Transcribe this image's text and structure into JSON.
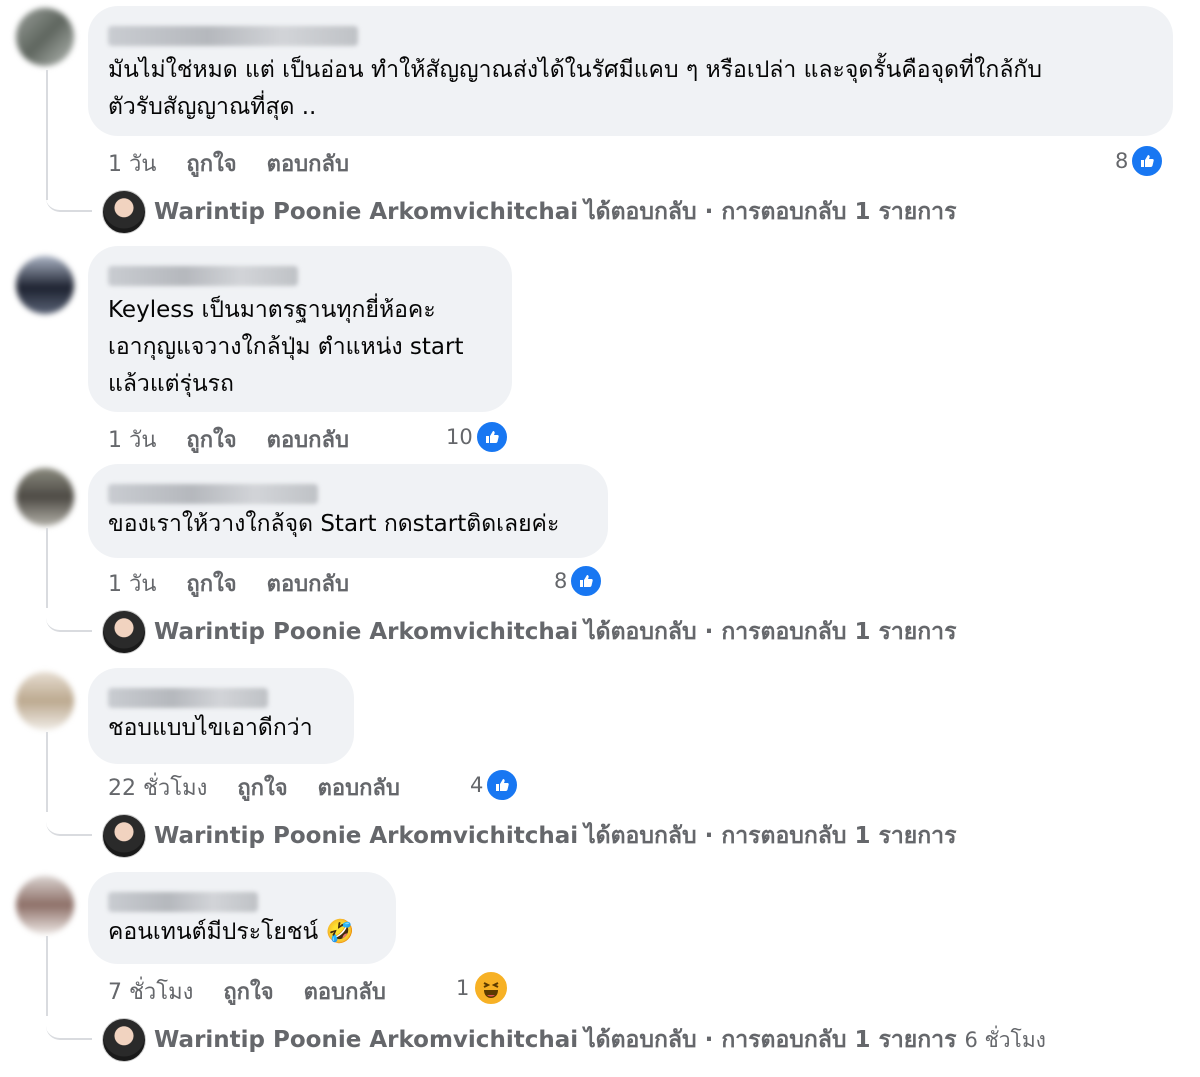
{
  "comments": [
    {
      "text": "มันไม่ใช่หมด แต่ เป็นอ่อน ทำให้สัญญาณส่งได้ในรัศมีแคบ ๆ หรือเปล่า และจุดรั้นคือจุดที่ใกล้กับ\nตัวรับสัญญาณที่สุด ..",
      "time": "1 วัน",
      "like_label": "ถูกใจ",
      "reply_label": "ตอบกลับ",
      "reaction_count": "8",
      "reaction": "like-icon",
      "reply_summary": {
        "name": "Warintip Poonie Arkomvichitchai",
        "text": "ได้ตอบกลับ · การตอบกลับ 1 รายการ",
        "extra": ""
      }
    },
    {
      "text": "Keyless เป็นมาตรฐานทุกยี่ห้อคะ\nเอากุญแจวางใกล้ปุ่ม ตำแหน่ง start\nแล้วแต่รุ่นรถ",
      "time": "1 วัน",
      "like_label": "ถูกใจ",
      "reply_label": "ตอบกลับ",
      "reaction_count": "10",
      "reaction": "like-icon"
    },
    {
      "text": "ของเราให้วางใกล้จุด Start กดstartติดเลยค่ะ",
      "time": "1 วัน",
      "like_label": "ถูกใจ",
      "reply_label": "ตอบกลับ",
      "reaction_count": "8",
      "reaction": "like-icon",
      "reply_summary": {
        "name": "Warintip Poonie Arkomvichitchai",
        "text": "ได้ตอบกลับ · การตอบกลับ 1 รายการ",
        "extra": ""
      }
    },
    {
      "text": "ชอบแบบไขเอาดีกว่า",
      "time": "22 ชั่วโมง",
      "like_label": "ถูกใจ",
      "reply_label": "ตอบกลับ",
      "reaction_count": "4",
      "reaction": "like-icon",
      "reply_summary": {
        "name": "Warintip Poonie Arkomvichitchai",
        "text": "ได้ตอบกลับ · การตอบกลับ 1 รายการ",
        "extra": ""
      }
    },
    {
      "text": "คอนเทนต์มีประโยชน์ 🤣",
      "time": "7 ชั่วโมง",
      "like_label": "ถูกใจ",
      "reply_label": "ตอบกลับ",
      "reaction_count": "1",
      "reaction": "haha-icon",
      "reply_summary": {
        "name": "Warintip Poonie Arkomvichitchai",
        "text": "ได้ตอบกลับ · การตอบกลับ 1 รายการ",
        "extra": "6 ชั่วโมง"
      }
    }
  ],
  "colors": {
    "bubble": "#f0f2f5",
    "meta_text": "#65676b",
    "like_blue": "#1877f2",
    "haha_yellow": "#f7b125"
  }
}
